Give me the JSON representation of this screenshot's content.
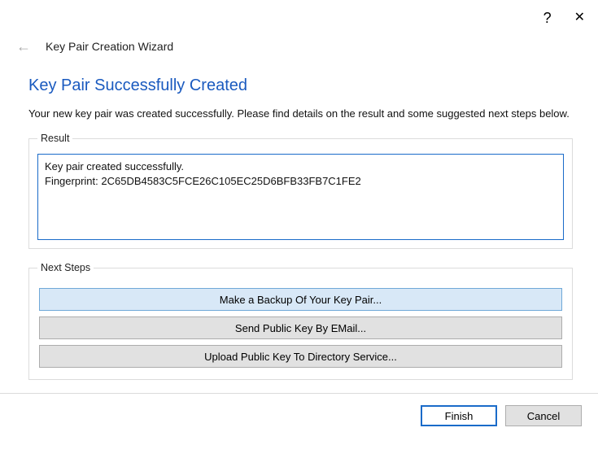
{
  "titlebar": {
    "help": "?",
    "close": "✕"
  },
  "subheader": {
    "back_arrow": "←",
    "wizard_title": "Key Pair Creation Wizard"
  },
  "page": {
    "heading": "Key Pair Successfully Created",
    "description": "Your new key pair was created successfully. Please find details on the result and some suggested next steps below."
  },
  "result": {
    "legend": "Result",
    "text": "Key pair created successfully.\nFingerprint: 2C65DB4583C5FCE26C105EC25D6BFB33FB7C1FE2"
  },
  "next_steps": {
    "legend": "Next Steps",
    "backup_label": "Make a Backup Of Your Key Pair...",
    "send_email_label": "Send Public Key By EMail...",
    "upload_label": "Upload Public Key To Directory Service..."
  },
  "footer": {
    "finish": "Finish",
    "cancel": "Cancel"
  }
}
